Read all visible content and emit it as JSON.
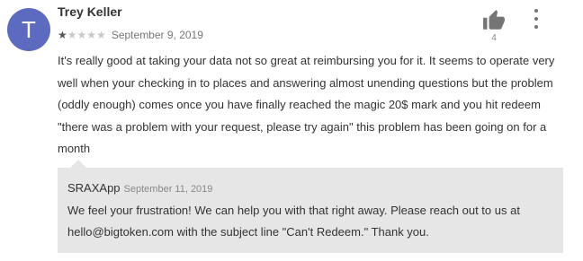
{
  "review": {
    "avatar_initial": "T",
    "author": "Trey Keller",
    "rating": 1,
    "rating_max": 5,
    "date": "September 9, 2019",
    "thumbs_up_count": "4",
    "body": "It's really good at taking your data not so great at reimbursing you for it. It seems to operate very well when your checking in to places and answering almost unending questions but the problem (oddly enough) comes once you have finally reached the magic 20$ mark and you hit redeem \"there was a problem with your request, please try again\" this problem has been going on for a month"
  },
  "reply": {
    "author": "SRAXApp",
    "date": "September 11, 2019",
    "text": "We feel your frustration! We can help you with that right away. Please reach out to us at hello@bigtoken.com with the subject line \"Can't Redeem.\" Thank you."
  },
  "colors": {
    "avatar_bg": "#5c6bc0",
    "reply_bg": "#e6e6e6"
  },
  "icons": {
    "helpful": "thumbs-up-icon",
    "menu": "more-vert-icon",
    "star": "star-icon"
  }
}
